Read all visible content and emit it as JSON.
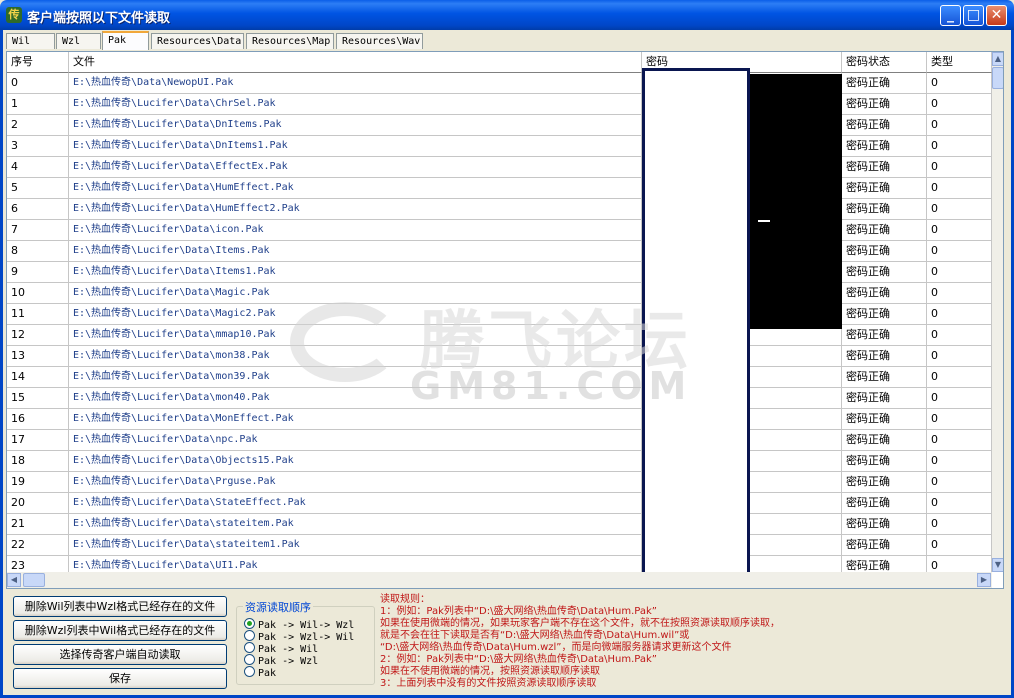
{
  "window": {
    "title": "客户端按照以下文件读取",
    "app_icon_glyph": "传"
  },
  "tabs": [
    {
      "label": "Wil",
      "active": false
    },
    {
      "label": "Wzl",
      "active": false
    },
    {
      "label": "Pak",
      "active": true
    },
    {
      "label": "Resources\\Data",
      "active": false
    },
    {
      "label": "Resources\\Map",
      "active": false
    },
    {
      "label": "Resources\\Wav",
      "active": false
    }
  ],
  "table": {
    "columns": [
      "序号",
      "文件",
      "密码",
      "密码状态",
      "类型"
    ],
    "rows": [
      [
        "0",
        "E:\\热血传奇\\Data\\NewopUI.Pak",
        "",
        "密码正确",
        "0"
      ],
      [
        "1",
        "E:\\热血传奇\\Lucifer\\Data\\ChrSel.Pak",
        "",
        "密码正确",
        "0"
      ],
      [
        "2",
        "E:\\热血传奇\\Lucifer\\Data\\DnItems.Pak",
        "",
        "密码正确",
        "0"
      ],
      [
        "3",
        "E:\\热血传奇\\Lucifer\\Data\\DnItems1.Pak",
        "",
        "密码正确",
        "0"
      ],
      [
        "4",
        "E:\\热血传奇\\Lucifer\\Data\\EffectEx.Pak",
        "",
        "密码正确",
        "0"
      ],
      [
        "5",
        "E:\\热血传奇\\Lucifer\\Data\\HumEffect.Pak",
        "",
        "密码正确",
        "0"
      ],
      [
        "6",
        "E:\\热血传奇\\Lucifer\\Data\\HumEffect2.Pak",
        "",
        "密码正确",
        "0"
      ],
      [
        "7",
        "E:\\热血传奇\\Lucifer\\Data\\icon.Pak",
        "",
        "密码正确",
        "0"
      ],
      [
        "8",
        "E:\\热血传奇\\Lucifer\\Data\\Items.Pak",
        "",
        "密码正确",
        "0"
      ],
      [
        "9",
        "E:\\热血传奇\\Lucifer\\Data\\Items1.Pak",
        "",
        "密码正确",
        "0"
      ],
      [
        "10",
        "E:\\热血传奇\\Lucifer\\Data\\Magic.Pak",
        "",
        "密码正确",
        "0"
      ],
      [
        "11",
        "E:\\热血传奇\\Lucifer\\Data\\Magic2.Pak",
        "",
        "密码正确",
        "0"
      ],
      [
        "12",
        "E:\\热血传奇\\Lucifer\\Data\\mmap10.Pak",
        "",
        "密码正确",
        "0"
      ],
      [
        "13",
        "E:\\热血传奇\\Lucifer\\Data\\mon38.Pak",
        "",
        "密码正确",
        "0"
      ],
      [
        "14",
        "E:\\热血传奇\\Lucifer\\Data\\mon39.Pak",
        "",
        "密码正确",
        "0"
      ],
      [
        "15",
        "E:\\热血传奇\\Lucifer\\Data\\mon40.Pak",
        "",
        "密码正确",
        "0"
      ],
      [
        "16",
        "E:\\热血传奇\\Lucifer\\Data\\MonEffect.Pak",
        "",
        "密码正确",
        "0"
      ],
      [
        "17",
        "E:\\热血传奇\\Lucifer\\Data\\npc.Pak",
        "",
        "密码正确",
        "0"
      ],
      [
        "18",
        "E:\\热血传奇\\Lucifer\\Data\\Objects15.Pak",
        "",
        "密码正确",
        "0"
      ],
      [
        "19",
        "E:\\热血传奇\\Lucifer\\Data\\Prguse.Pak",
        "",
        "密码正确",
        "0"
      ],
      [
        "20",
        "E:\\热血传奇\\Lucifer\\Data\\StateEffect.Pak",
        "",
        "密码正确",
        "0"
      ],
      [
        "21",
        "E:\\热血传奇\\Lucifer\\Data\\stateitem.Pak",
        "",
        "密码正确",
        "0"
      ],
      [
        "22",
        "E:\\热血传奇\\Lucifer\\Data\\stateitem1.Pak",
        "",
        "密码正确",
        "0"
      ],
      [
        "23",
        "E:\\热血传奇\\Lucifer\\Data\\UI1.Pak",
        "",
        "密码正确",
        "0"
      ]
    ]
  },
  "watermark": {
    "cn": "腾飞论坛",
    "en": "GM81.COM"
  },
  "buttons": {
    "delete_wil": "删除Wil列表中Wzl格式已经存在的文件",
    "delete_wzl": "删除Wzl列表中Wil格式已经存在的文件",
    "auto_read": "选择传奇客户端自动读取",
    "save": "保存"
  },
  "resource_order": {
    "legend": "资源读取顺序",
    "options": [
      {
        "label": "Pak -> Wil-> Wzl",
        "selected": true
      },
      {
        "label": "Pak -> Wzl-> Wil",
        "selected": false
      },
      {
        "label": "Pak -> Wil",
        "selected": false
      },
      {
        "label": "Pak -> Wzl",
        "selected": false
      },
      {
        "label": "Pak",
        "selected": false
      }
    ]
  },
  "rules": [
    "读取规则：",
    "1：例如：Pak列表中“D:\\盛大网络\\热血传奇\\Data\\Hum.Pak”",
    "    如果在使用微端的情况，如果玩家客户端不存在这个文件，就不在按照资源读取顺序读取，",
    "    就是不会在往下读取是否有“D:\\盛大网络\\热血传奇\\Data\\Hum.wil”或",
    "    “D:\\盛大网络\\热血传奇\\Data\\Hum.wzl”，而是向微端服务器请求更新这个文件",
    "2：例如：Pak列表中“D:\\盛大网络\\热血传奇\\Data\\Hum.Pak”",
    "    如果在不使用微端的情况，按照资源读取顺序读取",
    "3：上面列表中没有的文件按照资源读取顺序读取"
  ],
  "colors": {
    "titlebar": "#0054e3",
    "rules_text": "#c01818",
    "legend_text": "#0046d5"
  }
}
